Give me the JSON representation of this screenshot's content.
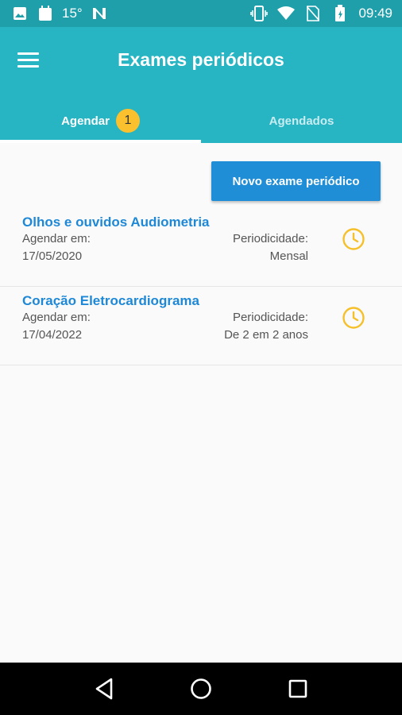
{
  "status_bar": {
    "temperature": "15°",
    "time": "09:49",
    "left_icons": [
      "image-icon",
      "calendar-icon",
      "n-icon"
    ],
    "right_icons": [
      "vibrate-icon",
      "wifi-icon",
      "no-sim-icon",
      "battery-icon"
    ]
  },
  "app_bar": {
    "title": "Exames periódicos",
    "menu_icon": "menu-icon",
    "background_color": "#27b4c3"
  },
  "tabs": [
    {
      "label": "Agendar",
      "badge": "1",
      "selected": true
    },
    {
      "label": "Agendados",
      "selected": false
    }
  ],
  "actions": {
    "new_exam_label": "Novo exame periódico"
  },
  "exams": [
    {
      "title": "Olhos e ouvidos Audiometria",
      "schedule_label": "Agendar em:",
      "date": "17/05/2020",
      "periodicity_label": "Periodicidade:",
      "periodicity": "Mensal",
      "icon": "clock-icon"
    },
    {
      "title": "Coração Eletrocardiograma",
      "schedule_label": "Agendar em:",
      "date": "17/04/2022",
      "periodicity_label": "Periodicidade:",
      "periodicity": "De 2 em 2 anos",
      "icon": "clock-icon"
    }
  ],
  "nav_bar": {
    "icons": [
      "back-icon",
      "home-icon",
      "recents-icon"
    ]
  },
  "colors": {
    "accent": "#1e88d6",
    "badge": "#fbc02d",
    "clock": "#f5c02a"
  }
}
